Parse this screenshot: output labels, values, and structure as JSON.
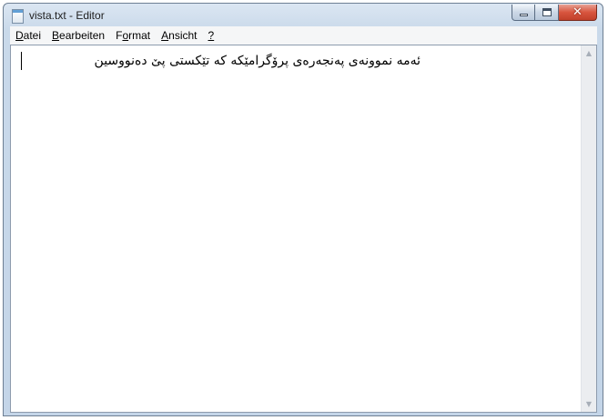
{
  "window": {
    "title": "vista.txt - Editor",
    "app_icon": "notepad-icon"
  },
  "caption_buttons": {
    "minimize_icon": "minimize-icon",
    "maximize_icon": "maximize-icon",
    "close_icon": "close-icon",
    "close_glyph": "✕"
  },
  "menu": {
    "items": [
      {
        "first": "D",
        "rest": "atei"
      },
      {
        "first": "B",
        "rest": "earbeiten"
      },
      {
        "pre": "F",
        "first": "o",
        "rest": "rmat"
      },
      {
        "first": "A",
        "rest": "nsicht"
      },
      {
        "first": "?",
        "rest": ""
      }
    ]
  },
  "editor": {
    "text": "ئەمە نموونەی پەنجەرەی پرۆگرامێکە کە تێکستی پێ دەنووسین"
  },
  "scrollbar": {
    "up_icon": "scroll-up-arrow-icon",
    "down_icon": "scroll-down-arrow-icon",
    "up_glyph": "▲",
    "down_glyph": "▼"
  },
  "colors": {
    "title_bar": "#c9d9ea",
    "close_button": "#d8553e",
    "menu_bar": "#f5f6f7",
    "editor_background": "#ffffff"
  }
}
